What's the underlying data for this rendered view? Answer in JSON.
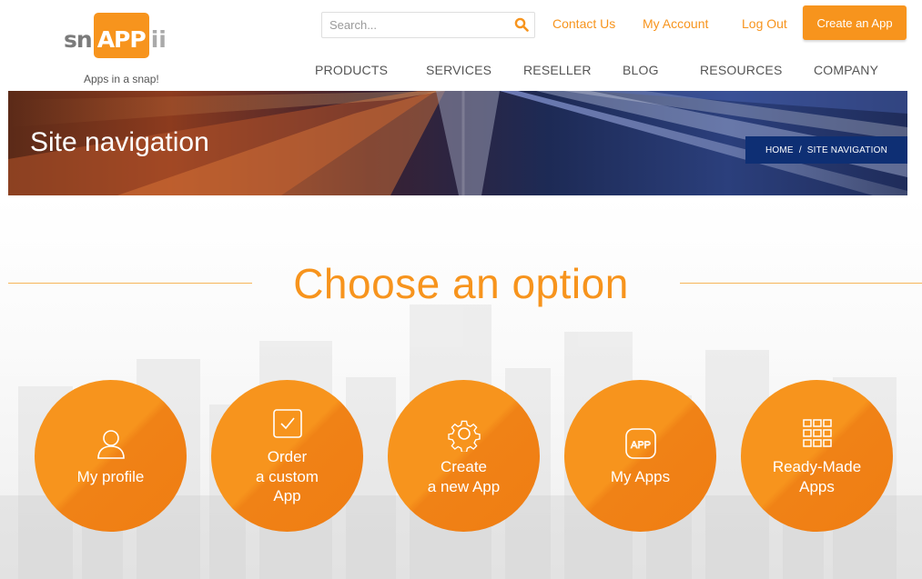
{
  "logo": {
    "mark_left": "sn",
    "mark_box": "APP",
    "mark_right": "ii",
    "tagline": "Apps in a snap!"
  },
  "search": {
    "placeholder": "Search..."
  },
  "top_links": {
    "contact": "Contact Us",
    "account": "My Account",
    "logout": "Log Out"
  },
  "cta": {
    "label": "Create an App"
  },
  "nav": [
    "PRODUCTS",
    "SERVICES",
    "RESELLER",
    "BLOG",
    "RESOURCES",
    "COMPANY"
  ],
  "banner": {
    "title": "Site navigation",
    "breadcrumb": {
      "home": "HOME",
      "separator": "/",
      "current": "SITE NAVIGATION"
    }
  },
  "main": {
    "heading": "Choose an option",
    "options": [
      {
        "label": "My profile",
        "icon": "user-icon"
      },
      {
        "label": "Order\na custom\nApp",
        "icon": "checkbox-icon"
      },
      {
        "label": "Create\na new App",
        "icon": "gear-icon"
      },
      {
        "label": "My Apps",
        "icon": "app-icon"
      },
      {
        "label": "Ready-Made\nApps",
        "icon": "grid-icon"
      }
    ]
  },
  "colors": {
    "brand_orange": "#f7941d",
    "breadcrumb_bg": "#0e2f74",
    "nav_text": "#555555"
  }
}
